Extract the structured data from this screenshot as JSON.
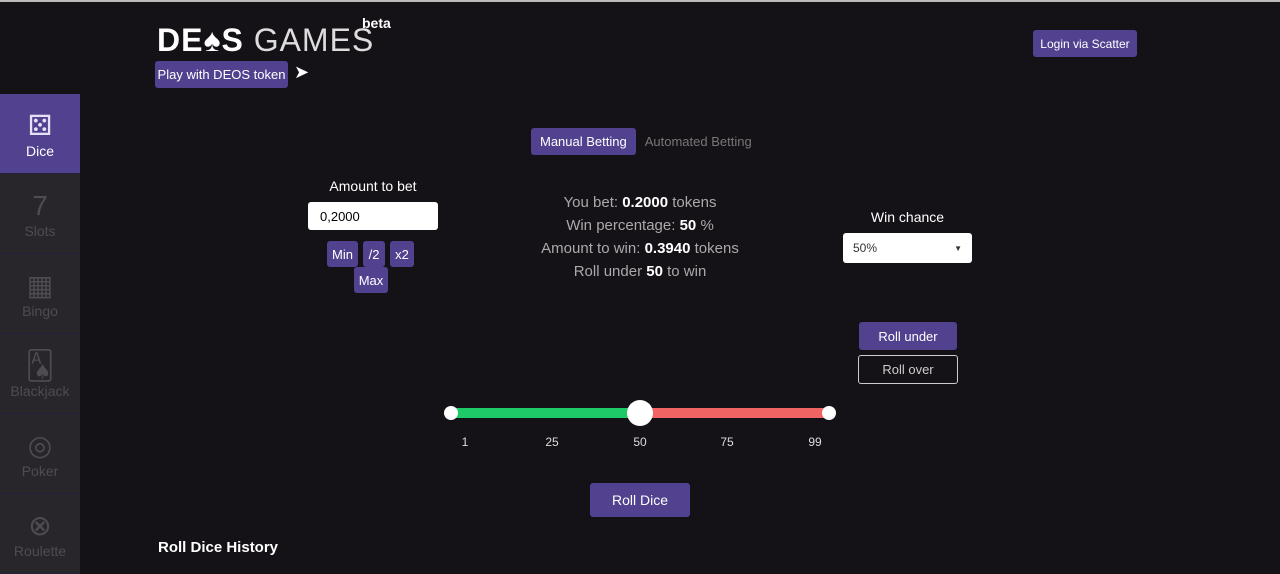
{
  "header": {
    "logo_bold": "DE",
    "logo_spade": "♠",
    "logo_bold2": "S",
    "logo_light": " GAMES",
    "beta": "beta",
    "play_button": "Play with DEOS token",
    "login_button": "Login via Scatter",
    "telegram_icon": "paper-plane-icon"
  },
  "sidebar": {
    "items": [
      {
        "label": "Dice",
        "icon": "⚄",
        "active": true
      },
      {
        "label": "Slots",
        "icon": "7"
      },
      {
        "label": "Bingo",
        "icon": "▦"
      },
      {
        "label": "Blackjack",
        "icon": "🂡"
      },
      {
        "label": "Poker",
        "icon": "◎"
      },
      {
        "label": "Roulette",
        "icon": "⊗"
      }
    ]
  },
  "tabs": [
    "Manual Betting",
    "Automated Betting"
  ],
  "bet": {
    "label": "Amount to bet",
    "value": "0,2000",
    "min": "Min",
    "half": "/2",
    "double": "x2",
    "max": "Max"
  },
  "info": {
    "you_bet_label": "You bet:",
    "you_bet": "0.2000",
    "tokens": "tokens",
    "win_pct_label": "Win percentage:",
    "win_pct": "50",
    "pct": "%",
    "amount_win_label": "Amount to win:",
    "amount_win": "0.3940",
    "roll_under_label": "Roll under",
    "roll_under": "50",
    "to_win": "to win"
  },
  "win_chance": {
    "label": "Win chance",
    "value": "50%"
  },
  "roll_under_button": "Roll under",
  "roll_over_button": "Roll over",
  "slider": {
    "min": 1,
    "max": 99,
    "value": 50,
    "ticks": [
      "1",
      "25",
      "50",
      "75",
      "99"
    ],
    "colors": {
      "under": "#1ec968",
      "over": "#f06464"
    }
  },
  "roll_button": "Roll Dice",
  "history_title": "Roll Dice History"
}
